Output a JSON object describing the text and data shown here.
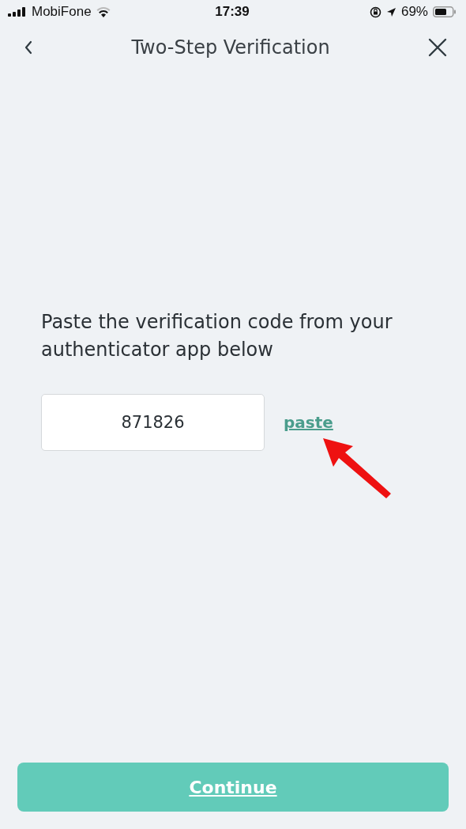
{
  "status_bar": {
    "carrier": "MobiFone",
    "time": "17:39",
    "battery": "69%"
  },
  "header": {
    "title": "Two-Step Verification"
  },
  "prompt": "Paste the verification code from your authenticator app below",
  "code_field": {
    "value": "871826"
  },
  "paste_link": "paste",
  "continue_button": "Continue"
}
